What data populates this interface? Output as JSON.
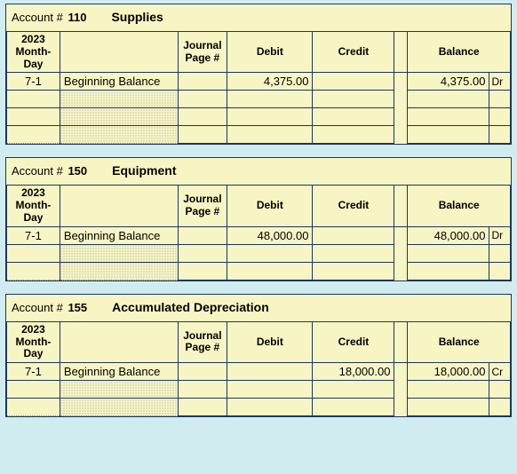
{
  "headers": {
    "account_label": "Account #",
    "year": "2023",
    "month_day": "Month-Day",
    "journal_l1": "Journal",
    "journal_l2": "Page #",
    "debit": "Debit",
    "credit": "Credit",
    "balance": "Balance"
  },
  "ledgers": [
    {
      "account_no": "110",
      "account_title": "Supplies",
      "rows": [
        {
          "date": "7-1",
          "desc": "Beginning Balance",
          "journal": "",
          "debit": "4,375.00",
          "credit": "",
          "balance": "4,375.00",
          "dc": "Dr"
        },
        {
          "date": "",
          "desc": "",
          "journal": "",
          "debit": "",
          "credit": "",
          "balance": "",
          "dc": ""
        },
        {
          "date": "",
          "desc": "",
          "journal": "",
          "debit": "",
          "credit": "",
          "balance": "",
          "dc": ""
        },
        {
          "date": "",
          "desc": "",
          "journal": "",
          "debit": "",
          "credit": "",
          "balance": "",
          "dc": ""
        }
      ]
    },
    {
      "account_no": "150",
      "account_title": "Equipment",
      "rows": [
        {
          "date": "7-1",
          "desc": "Beginning Balance",
          "journal": "",
          "debit": "48,000.00",
          "credit": "",
          "balance": "48,000.00",
          "dc": "Dr"
        },
        {
          "date": "",
          "desc": "",
          "journal": "",
          "debit": "",
          "credit": "",
          "balance": "",
          "dc": ""
        },
        {
          "date": "",
          "desc": "",
          "journal": "",
          "debit": "",
          "credit": "",
          "balance": "",
          "dc": ""
        }
      ]
    },
    {
      "account_no": "155",
      "account_title": "Accumulated Depreciation",
      "rows": [
        {
          "date": "7-1",
          "desc": "Beginning Balance",
          "journal": "",
          "debit": "",
          "credit": "18,000.00",
          "balance": "18,000.00",
          "dc": "Cr"
        },
        {
          "date": "",
          "desc": "",
          "journal": "",
          "debit": "",
          "credit": "",
          "balance": "",
          "dc": ""
        },
        {
          "date": "",
          "desc": "",
          "journal": "",
          "debit": "",
          "credit": "",
          "balance": "",
          "dc": ""
        }
      ]
    }
  ]
}
